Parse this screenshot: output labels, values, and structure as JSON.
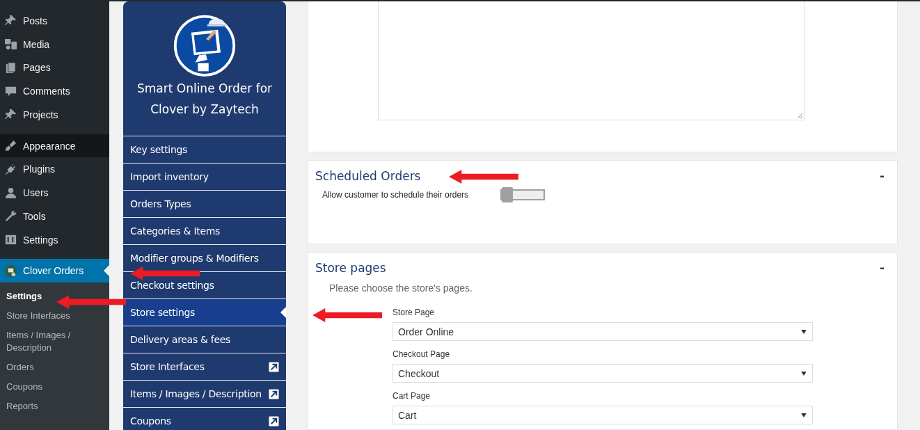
{
  "admin_menu": {
    "groups": [
      {
        "items": [
          {
            "label": "Posts",
            "hovered": false,
            "selected": false
          },
          {
            "label": "Media",
            "hovered": false,
            "selected": false
          },
          {
            "label": "Pages",
            "hovered": false,
            "selected": false
          },
          {
            "label": "Comments",
            "hovered": false,
            "selected": false
          },
          {
            "label": "Projects",
            "hovered": false,
            "selected": false
          }
        ]
      },
      {
        "items": [
          {
            "label": "Appearance",
            "hovered": true,
            "selected": false
          },
          {
            "label": "Plugins",
            "hovered": false,
            "selected": false
          },
          {
            "label": "Users",
            "hovered": false,
            "selected": false
          },
          {
            "label": "Tools",
            "hovered": false,
            "selected": false
          },
          {
            "label": "Settings",
            "hovered": false,
            "selected": false
          }
        ]
      },
      {
        "items": [
          {
            "label": "Clover Orders",
            "hovered": false,
            "selected": true
          }
        ]
      }
    ],
    "submenu": [
      {
        "label": "Settings",
        "selected": true
      },
      {
        "label": "Store Interfaces",
        "selected": false
      },
      {
        "label": "Items / Images / Description",
        "selected": false
      },
      {
        "label": "Orders",
        "selected": false
      },
      {
        "label": "Coupons",
        "selected": false
      },
      {
        "label": "Reports",
        "selected": false
      }
    ]
  },
  "plugin_nav": {
    "title": "Smart Online Order for Clover by Zaytech",
    "items": [
      {
        "label": "Key settings",
        "selected": false,
        "external": false
      },
      {
        "label": "Import inventory",
        "selected": false,
        "external": false
      },
      {
        "label": "Orders Types",
        "selected": false,
        "external": false
      },
      {
        "label": "Categories & Items",
        "selected": false,
        "external": false
      },
      {
        "label": "Modifier groups & Modifiers",
        "selected": false,
        "external": false
      },
      {
        "label": "Checkout settings",
        "selected": false,
        "external": false
      },
      {
        "label": "Store settings",
        "selected": true,
        "external": false
      },
      {
        "label": "Delivery areas & fees",
        "selected": false,
        "external": false
      },
      {
        "label": "Store Interfaces",
        "selected": false,
        "external": true
      },
      {
        "label": "Items / Images / Description",
        "selected": false,
        "external": true
      },
      {
        "label": "Coupons",
        "selected": false,
        "external": true
      }
    ]
  },
  "scheduled_orders": {
    "title": "Scheduled Orders",
    "collapse": "-",
    "option": {
      "label": "Allow customer to schedule their orders",
      "on": false
    }
  },
  "store_pages": {
    "title": "Store pages",
    "collapse": "-",
    "description": "Please choose the store's pages.",
    "fields": [
      {
        "label": "Store Page",
        "value": "Order Online"
      },
      {
        "label": "Checkout Page",
        "value": "Checkout"
      },
      {
        "label": "Cart Page",
        "value": "Cart"
      }
    ]
  }
}
